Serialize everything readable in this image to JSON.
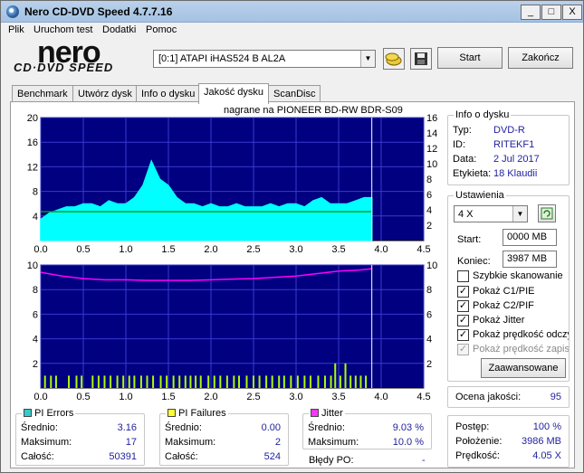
{
  "app": {
    "title": "Nero CD-DVD Speed 4.7.7.16",
    "window_buttons": [
      "_",
      "□",
      "X"
    ]
  },
  "menu": [
    "Plik",
    "Uruchom test",
    "Dodatki",
    "Pomoc"
  ],
  "logo": {
    "main": "nero",
    "sub": "CD·DVD SPEED"
  },
  "toolbar": {
    "drive": "[0:1]   ATAPI iHAS524   B AL2A",
    "start_label": "Start",
    "end_label": "Zakończ"
  },
  "tabs": [
    "Benchmark",
    "Utwórz dysk",
    "Info o dysku",
    "Jakość dysku",
    "ScanDisc"
  ],
  "active_tab": "Jakość dysku",
  "chart_header": "nagrane na PIONEER  BD-RW   BDR-S09",
  "disc_info": {
    "title": "Info o dysku",
    "rows": [
      {
        "label": "Typ:",
        "value": "DVD-R"
      },
      {
        "label": "ID:",
        "value": "RITEKF1"
      },
      {
        "label": "Data:",
        "value": "2 Jul 2017"
      },
      {
        "label": "Etykieta:",
        "value": "18 Klaudii"
      }
    ]
  },
  "settings": {
    "title": "Ustawienia",
    "speed": "4 X",
    "start_label": "Start:",
    "start_value": "0000 MB",
    "end_label": "Koniec:",
    "end_value": "3987 MB",
    "checkboxes": [
      {
        "label": "Szybkie skanowanie",
        "checked": false,
        "disabled": false
      },
      {
        "label": "Pokaż C1/PIE",
        "checked": true,
        "disabled": false
      },
      {
        "label": "Pokaż C2/PIF",
        "checked": true,
        "disabled": false
      },
      {
        "label": "Pokaż Jitter",
        "checked": true,
        "disabled": false
      },
      {
        "label": "Pokaż prędkość odczytu",
        "checked": true,
        "disabled": false
      },
      {
        "label": "Pokaż prędkość zapisu",
        "checked": true,
        "disabled": true
      }
    ],
    "advanced_label": "Zaawansowane"
  },
  "quality": {
    "label": "Ocena jakości:",
    "value": "95"
  },
  "progress": {
    "rows": [
      {
        "label": "Postęp:",
        "value": "100 %"
      },
      {
        "label": "Położenie:",
        "value": "3986 MB"
      },
      {
        "label": "Prędkość:",
        "value": "4.05 X"
      }
    ]
  },
  "pi_errors": {
    "title": "PI Errors",
    "color": "#33cccc",
    "rows": [
      {
        "label": "Średnio:",
        "value": "3.16"
      },
      {
        "label": "Maksimum:",
        "value": "17"
      },
      {
        "label": "Całość:",
        "value": "50391"
      }
    ]
  },
  "pi_failures": {
    "title": "PI Failures",
    "color": "#ffff33",
    "rows": [
      {
        "label": "Średnio:",
        "value": "0.00"
      },
      {
        "label": "Maksimum:",
        "value": "2"
      },
      {
        "label": "Całość:",
        "value": "524"
      }
    ]
  },
  "jitter": {
    "title": "Jitter",
    "color": "#ff33ff",
    "rows": [
      {
        "label": "Średnio:",
        "value": "9.03 %"
      },
      {
        "label": "Maksimum:",
        "value": "10.0 %"
      }
    ]
  },
  "bledy_po": {
    "label": "Błędy PO:",
    "value": "-"
  },
  "chart_data": [
    {
      "type": "area",
      "title": "",
      "x_ticks": [
        "0.0",
        "0.5",
        "1.0",
        "1.5",
        "2.0",
        "2.5",
        "3.0",
        "3.5",
        "4.0",
        "4.5"
      ],
      "y_ticks_left": [
        "4",
        "8",
        "12",
        "16",
        "20"
      ],
      "y_ticks_right": [
        "2",
        "4",
        "6",
        "8",
        "10",
        "12",
        "14",
        "16"
      ],
      "xlim": [
        0,
        4.5
      ],
      "ylim": [
        0,
        20
      ],
      "scan_end": 3.89,
      "series": [
        {
          "name": "PI Errors",
          "color": "#00ffff",
          "x": [
            0.0,
            0.1,
            0.2,
            0.3,
            0.4,
            0.5,
            0.6,
            0.7,
            0.8,
            0.9,
            1.0,
            1.1,
            1.2,
            1.3,
            1.4,
            1.5,
            1.6,
            1.7,
            1.8,
            1.9,
            2.0,
            2.1,
            2.2,
            2.3,
            2.4,
            2.5,
            2.6,
            2.7,
            2.8,
            2.9,
            3.0,
            3.1,
            3.2,
            3.3,
            3.4,
            3.5,
            3.6,
            3.7,
            3.8,
            3.89
          ],
          "values": [
            3.5,
            4.5,
            5,
            5.5,
            5.5,
            6,
            6,
            5.5,
            6.5,
            6,
            6,
            7,
            9,
            13,
            10,
            9,
            7,
            6,
            6,
            5.5,
            6,
            5.5,
            5.5,
            6,
            5.5,
            5.5,
            5.5,
            6,
            5.5,
            6,
            6,
            5.5,
            6.5,
            7,
            6,
            6,
            6,
            6.5,
            7,
            7
          ]
        },
        {
          "name": "Read speed",
          "color": "#00a000",
          "x": [
            0.0,
            3.89
          ],
          "values": [
            4.7,
            4.7
          ]
        }
      ]
    },
    {
      "type": "line",
      "title": "",
      "x_ticks": [
        "0.0",
        "0.5",
        "1.0",
        "1.5",
        "2.0",
        "2.5",
        "3.0",
        "3.5",
        "4.0",
        "4.5"
      ],
      "y_ticks_left": [
        "2",
        "4",
        "6",
        "8",
        "10"
      ],
      "y_ticks_right": [
        "2",
        "4",
        "6",
        "8",
        "10"
      ],
      "xlim": [
        0,
        4.5
      ],
      "ylim": [
        0,
        10
      ],
      "scan_end": 3.89,
      "series": [
        {
          "name": "Jitter",
          "color": "#ff00ff",
          "x": [
            0.0,
            0.25,
            0.5,
            0.75,
            1.0,
            1.25,
            1.5,
            1.75,
            2.0,
            2.25,
            2.5,
            2.75,
            3.0,
            3.25,
            3.5,
            3.75,
            3.89
          ],
          "values": [
            9.4,
            9.1,
            8.9,
            8.8,
            8.8,
            8.75,
            8.75,
            8.75,
            8.8,
            8.85,
            8.9,
            9.0,
            9.1,
            9.3,
            9.5,
            9.6,
            9.7
          ]
        },
        {
          "name": "PI Failures",
          "color": "#aaff00",
          "x": [
            0.05,
            0.12,
            0.18,
            0.33,
            0.42,
            0.48,
            0.61,
            0.68,
            0.75,
            0.82,
            0.9,
            0.97,
            1.04,
            1.1,
            1.18,
            1.25,
            1.32,
            1.41,
            1.48,
            1.56,
            1.63,
            1.7,
            1.76,
            1.82,
            1.88,
            1.97,
            2.04,
            2.11,
            2.19,
            2.27,
            2.33,
            2.42,
            2.5,
            2.57,
            2.65,
            2.72,
            2.8,
            2.86,
            2.94,
            3.02,
            3.1,
            3.17,
            3.26,
            3.34,
            3.41,
            3.46,
            3.52,
            3.58,
            3.64,
            3.7,
            3.76,
            3.82
          ],
          "values": [
            1,
            1,
            1,
            1,
            1,
            1,
            1,
            1,
            1,
            1,
            1,
            1,
            1,
            1,
            1,
            1,
            1,
            1,
            1,
            1,
            1,
            1,
            1,
            1,
            1,
            1,
            1,
            1,
            1,
            1,
            1,
            1,
            1,
            1,
            1,
            1,
            1,
            1,
            1,
            1,
            1,
            1,
            1,
            1,
            1,
            2,
            1,
            2,
            1,
            1,
            1,
            1
          ]
        }
      ]
    }
  ]
}
